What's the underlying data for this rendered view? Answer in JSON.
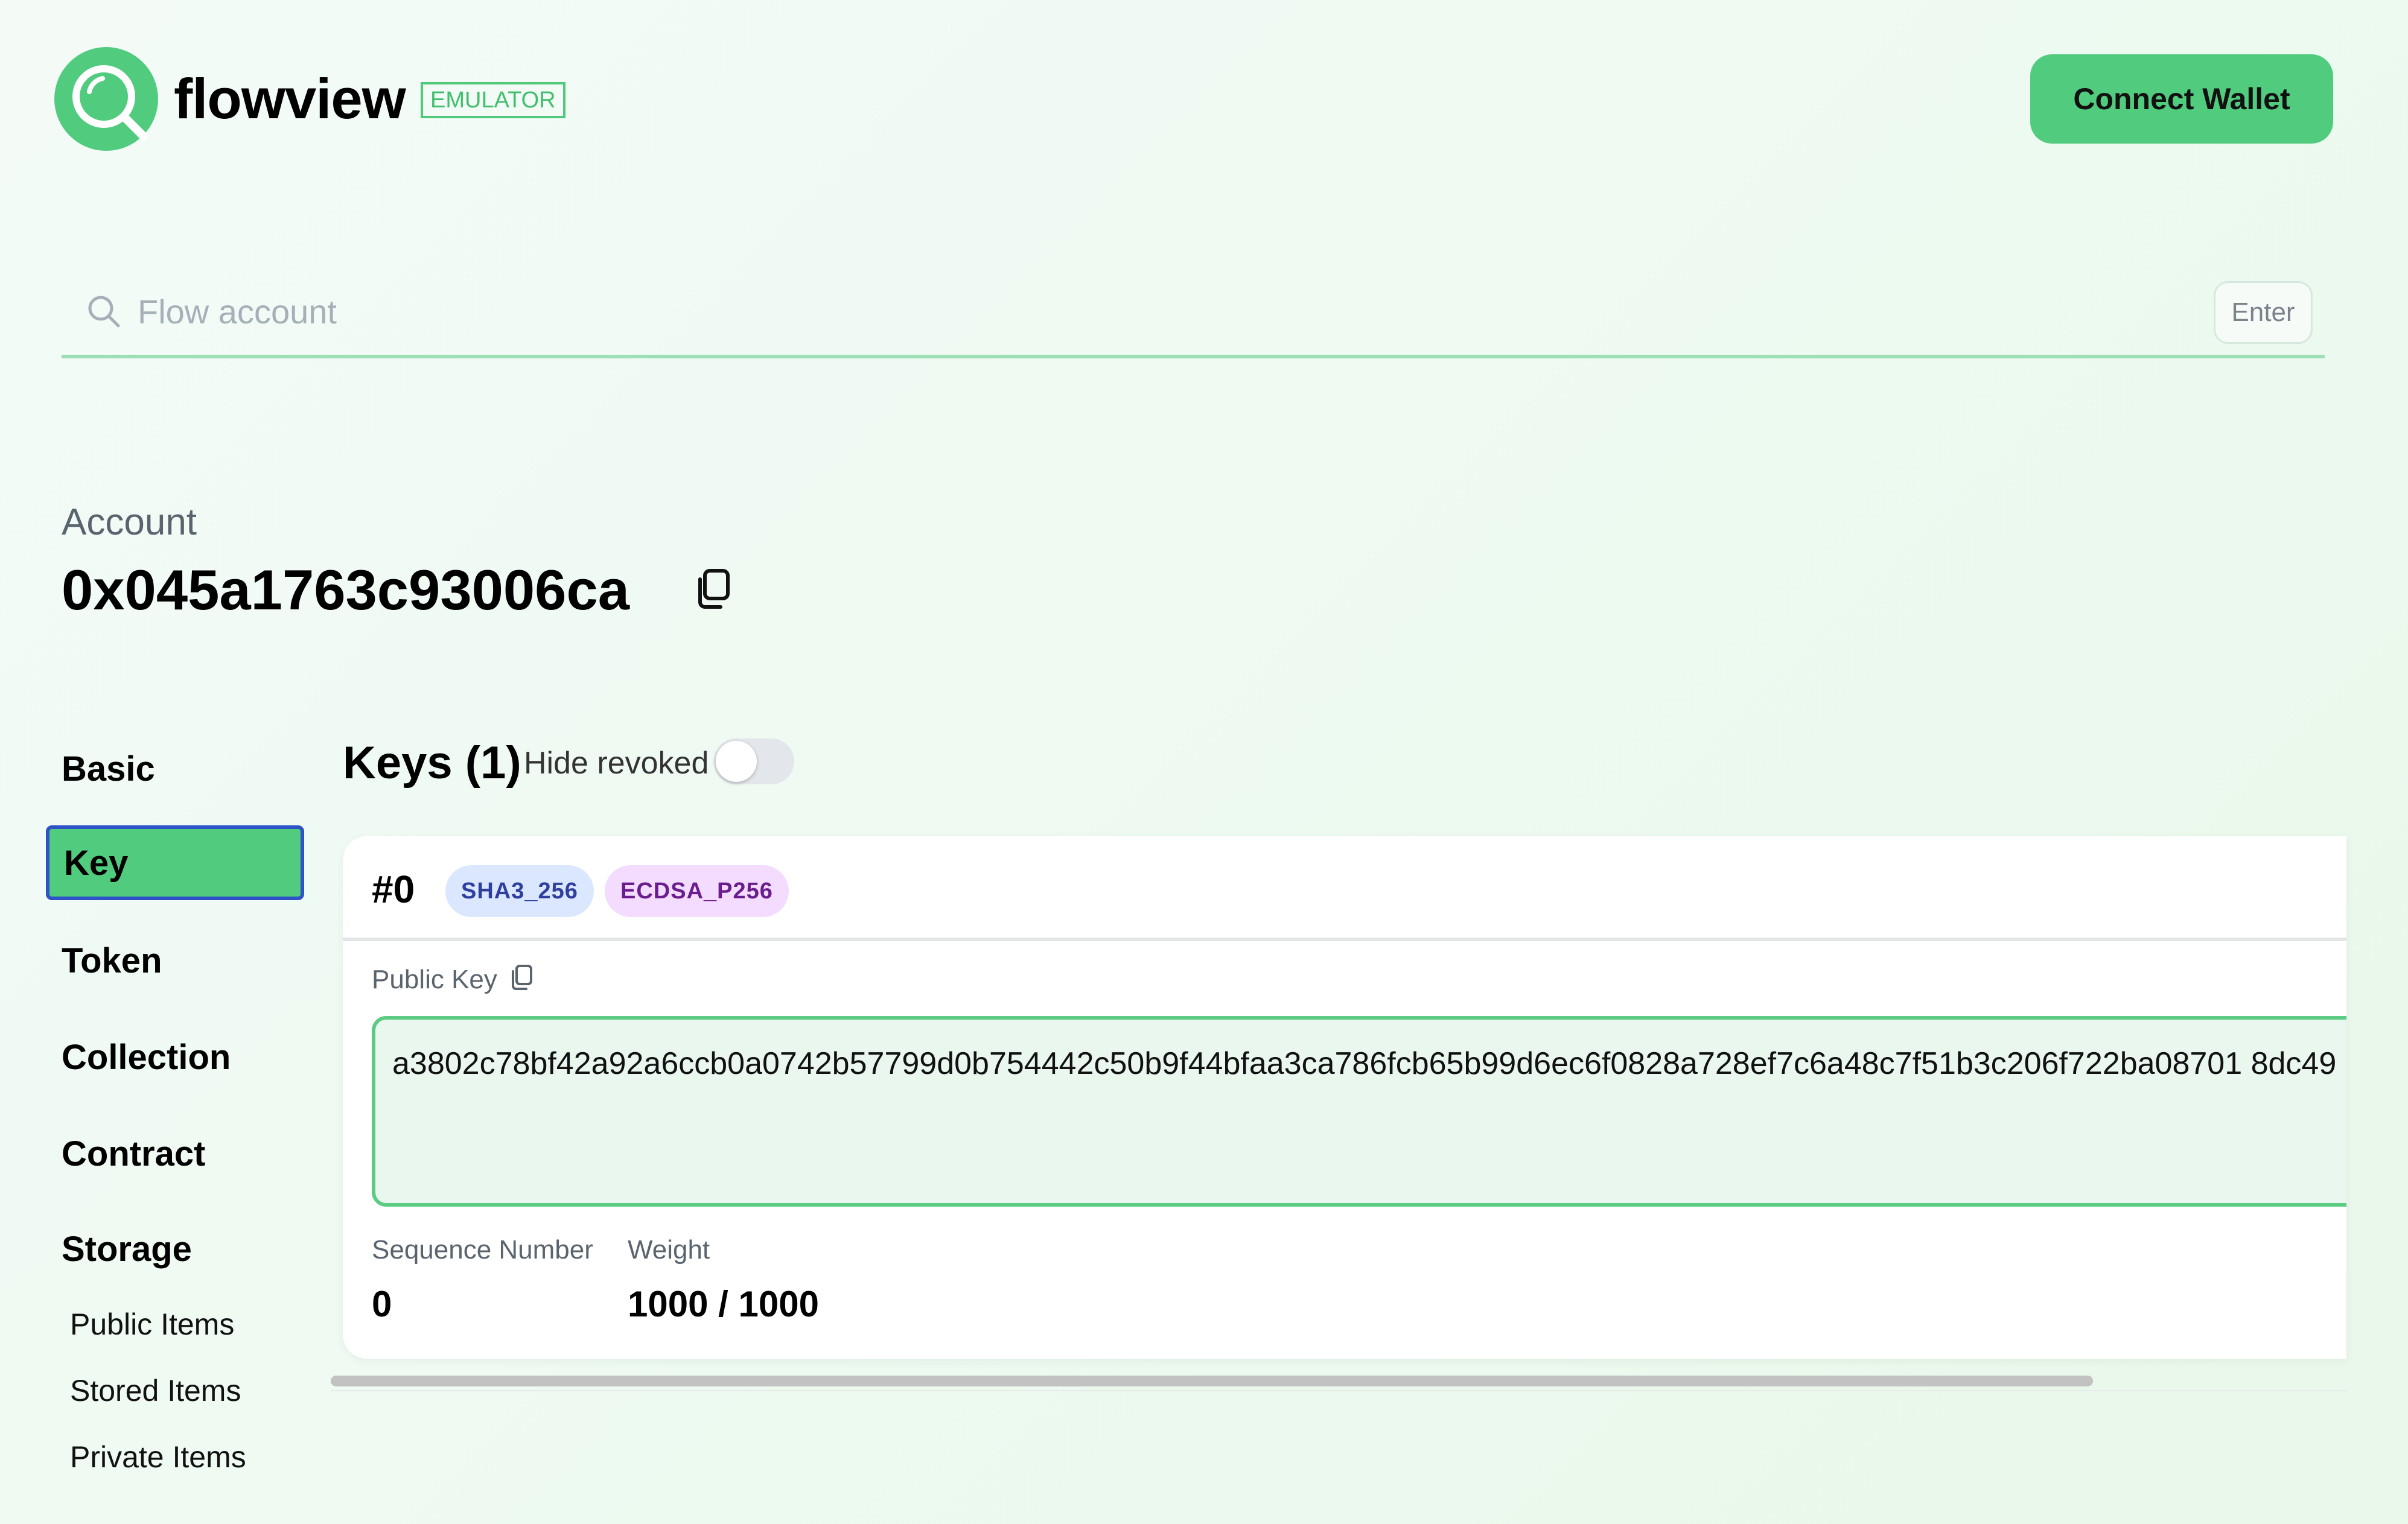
{
  "header": {
    "brand": "flowview",
    "env_badge": "EMULATOR",
    "connect_label": "Connect Wallet",
    "logo_icon": "magnifier-logo-icon",
    "brand_color": "#51cc7f"
  },
  "search": {
    "placeholder": "Flow account",
    "value": "",
    "enter_label": "Enter",
    "icon": "search-icon"
  },
  "account": {
    "label": "Account",
    "address": "0x045a1763c93006ca",
    "copy_icon": "copy-icon"
  },
  "sidebar": {
    "items": [
      {
        "label": "Basic"
      },
      {
        "label": "Key",
        "selected": true
      },
      {
        "label": "Token"
      },
      {
        "label": "Collection"
      },
      {
        "label": "Contract"
      },
      {
        "label": "Storage"
      }
    ],
    "storage_sub": [
      {
        "label": "Public Items"
      },
      {
        "label": "Stored Items"
      },
      {
        "label": "Private Items"
      }
    ]
  },
  "keys": {
    "title": "Keys (1)",
    "hide_revoked_label": "Hide revoked",
    "hide_revoked": false,
    "list": [
      {
        "index": "#0",
        "hash_algo": "SHA3_256",
        "sign_algo": "ECDSA_P256",
        "public_key_label": "Public Key",
        "public_key": "a3802c78bf42a92a6ccb0a0742b57799d0b754442c50b9f44bfaa3ca786fcb65b99d6ec6f0828a728ef7c6a48c7f51b3c206f722ba08701 8dc49",
        "sequence_label": "Sequence Number",
        "sequence": "0",
        "weight_label": "Weight",
        "weight": "1000 / 1000"
      }
    ]
  },
  "colors": {
    "accent": "#51cc7f",
    "selected_border": "#2e53c6",
    "hash_pill_bg": "#dbe7ff",
    "sign_pill_bg": "#f3dcff"
  }
}
